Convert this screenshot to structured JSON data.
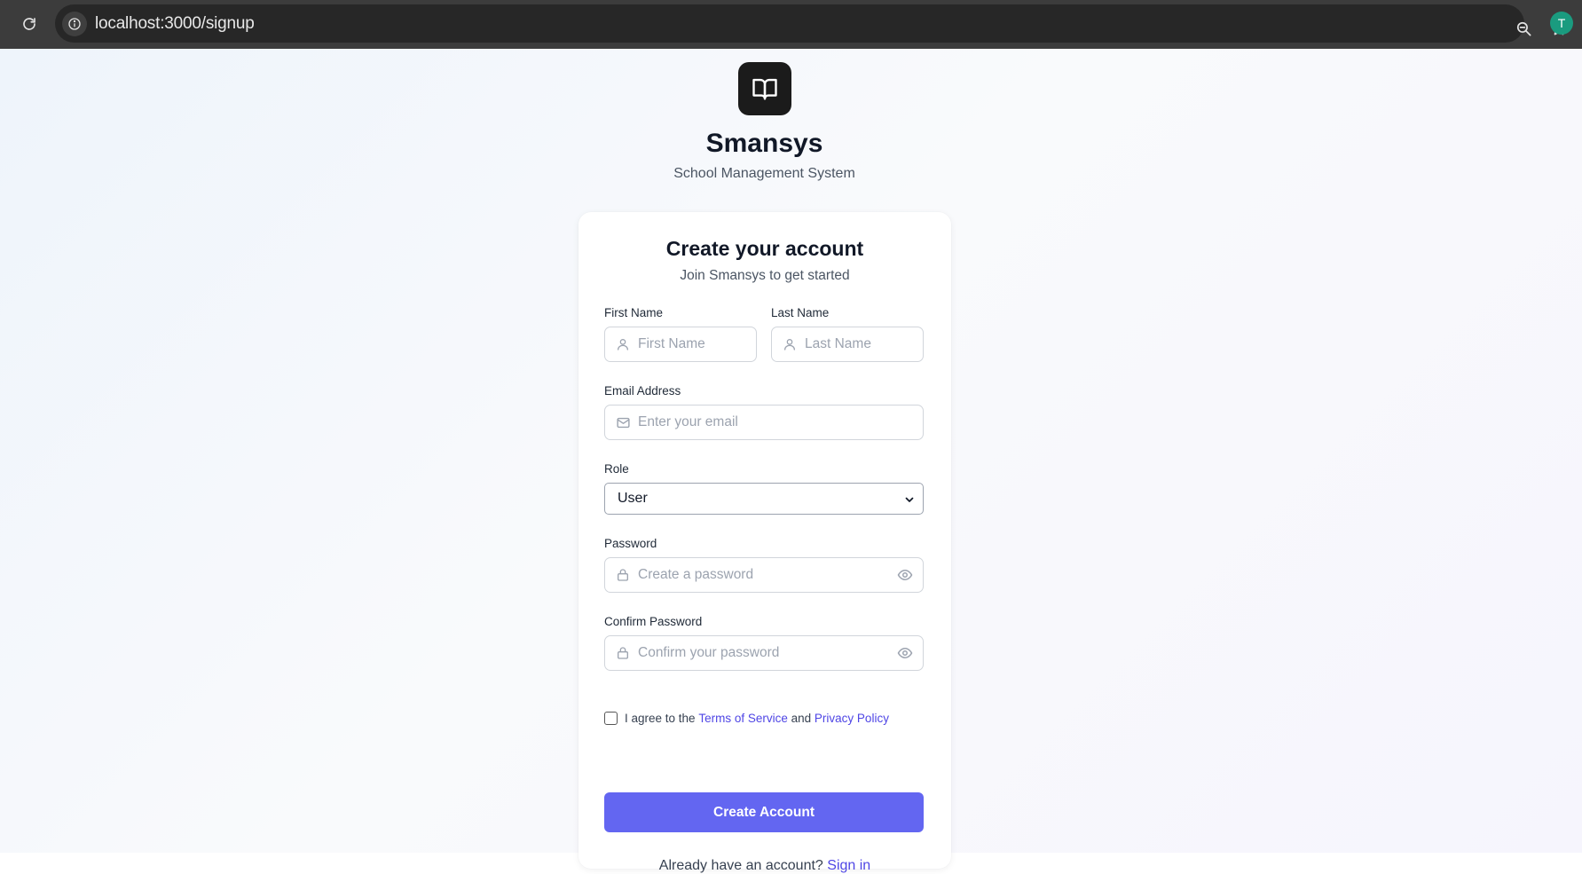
{
  "browser": {
    "url": "localhost:3000/signup",
    "profile_initial": "T",
    "icons": {
      "reload": "reload-icon",
      "site_info": "info-icon",
      "zoom": "zoom-icon",
      "bookmark": "star-icon"
    }
  },
  "brand": {
    "name": "Smansys",
    "tagline": "School Management System",
    "logo_icon": "book-open-icon"
  },
  "form": {
    "title": "Create your account",
    "subtitle": "Join Smansys to get started",
    "first_name": {
      "label": "First Name",
      "placeholder": "First Name",
      "value": ""
    },
    "last_name": {
      "label": "Last Name",
      "placeholder": "Last Name",
      "value": ""
    },
    "email": {
      "label": "Email Address",
      "placeholder": "Enter your email",
      "value": ""
    },
    "role": {
      "label": "Role",
      "selected": "User"
    },
    "password": {
      "label": "Password",
      "placeholder": "Create a password",
      "value": ""
    },
    "confirm_password": {
      "label": "Confirm Password",
      "placeholder": "Confirm your password",
      "value": ""
    },
    "terms": {
      "checked": false,
      "prefix": "I agree to the",
      "terms_link": "Terms of Service",
      "joiner": "and",
      "privacy_link": "Privacy Policy"
    },
    "submit_label": "Create Account",
    "signin_prompt": "Already have an account?",
    "signin_link": "Sign in"
  },
  "colors": {
    "accent": "#6366f1",
    "link": "#4f46e5",
    "logo_bg": "#1b1b1b",
    "avatar_bg": "#1a9b7f"
  }
}
